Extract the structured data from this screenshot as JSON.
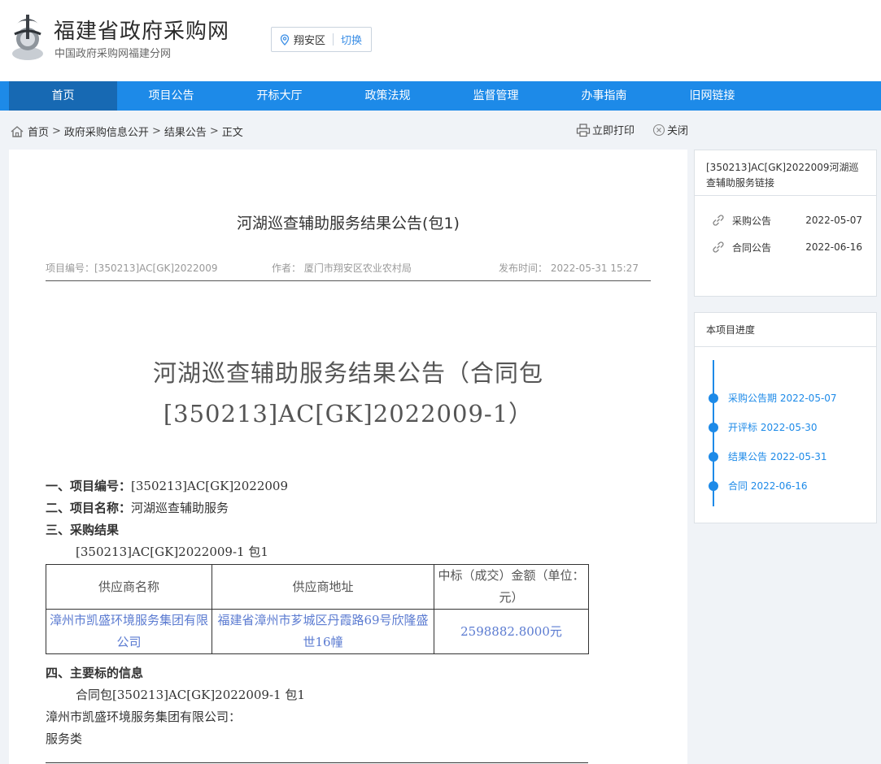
{
  "header": {
    "site_title": "福建省政府采购网",
    "site_subtitle": "中国政府采购网福建分网",
    "region": "翔安区",
    "region_switch": "切换"
  },
  "nav": [
    "首页",
    "项目公告",
    "开标大厅",
    "政策法规",
    "监督管理",
    "办事指南",
    "旧网链接"
  ],
  "breadcrumb": [
    "首页",
    "政府采购信息公开",
    "结果公告",
    "正文"
  ],
  "tools": {
    "print": "立即打印",
    "close": "关闭"
  },
  "article": {
    "title": "河湖巡查辅助服务结果公告(包1)",
    "meta_project": "项目编号：[350213]AC[GK]2022009",
    "meta_author": "作者：  厦门市翔安区农业农村局",
    "meta_time": "发布时间：  2022-05-31 15:27",
    "doc_title_line1": "河湖巡查辅助服务结果公告（合同包",
    "doc_title_line2": "[350213]AC[GK]2022009-1）",
    "s1_label": "一、项目编号：",
    "s1_value": "[350213]AC[GK]2022009",
    "s2_label": "二、项目名称：",
    "s2_value": "河湖巡查辅助服务",
    "s3_label": "三、采购结果",
    "s3_pkg": "[350213]AC[GK]2022009-1 包1",
    "table": {
      "headers": [
        "供应商名称",
        "供应商地址",
        "中标（成交）金额（单位：元）"
      ],
      "row": {
        "supplier": "漳州市凯盛环境服务集团有限公司",
        "address": "福建省漳州市芗城区丹霞路69号欣隆盛世16幢",
        "amount": "2598882.8000元"
      }
    },
    "s4_label": "四、主要标的信息",
    "s4_pkg": "合同包[350213]AC[GK]2022009-1 包1",
    "s4_supplier": "漳州市凯盛环境服务集团有限公司：",
    "s4_type": "服务类"
  },
  "sidebar": {
    "links_title": "[350213]AC[GK]2022009河湖巡查辅助服务链接",
    "links": [
      {
        "label": "采购公告",
        "date": "2022-05-07"
      },
      {
        "label": "合同公告",
        "date": "2022-06-16"
      }
    ],
    "progress_title": "本项目进度",
    "progress": [
      {
        "label": "采购公告期 2022-05-07"
      },
      {
        "label": "开评标 2022-05-30"
      },
      {
        "label": "结果公告 2022-05-31"
      },
      {
        "label": "合同 2022-06-16"
      }
    ]
  },
  "colors": {
    "nav_bg": "#1d8ae8",
    "nav_active": "#1769b3",
    "link_blue": "#1d8ae8"
  }
}
